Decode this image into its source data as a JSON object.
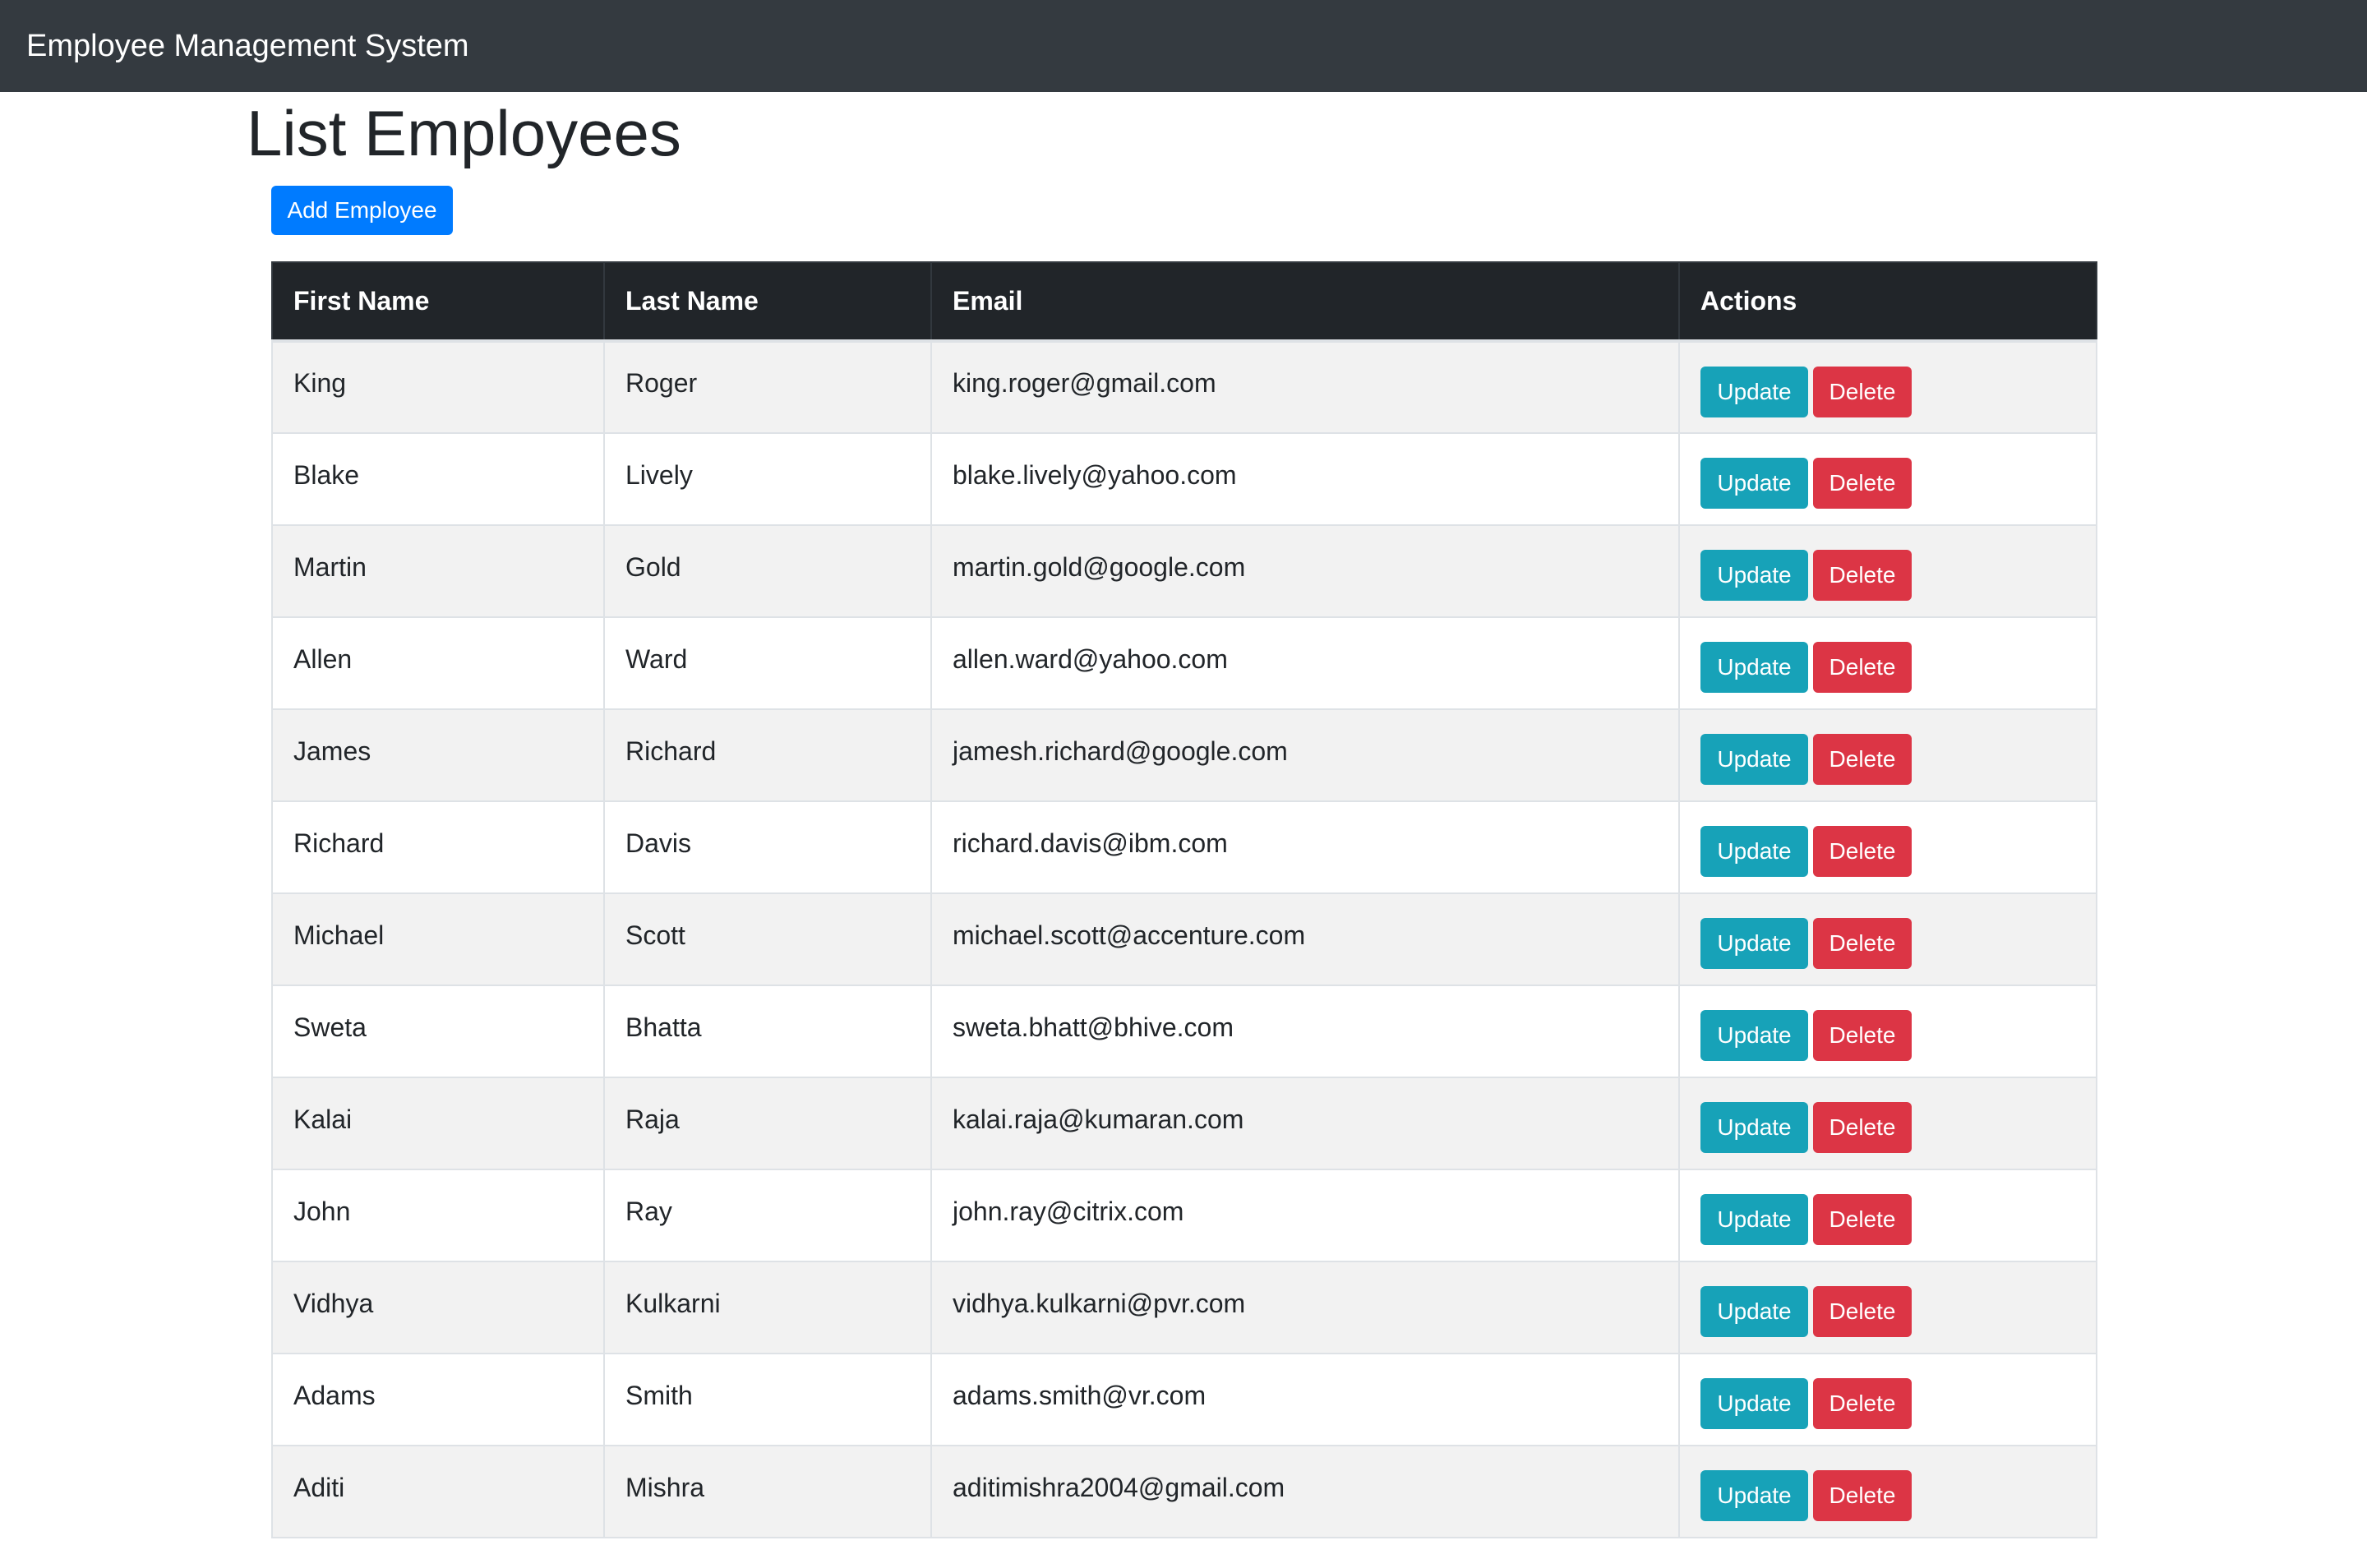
{
  "navbar": {
    "brand": "Employee Management System"
  },
  "page": {
    "title": "List Employees",
    "add_button_label": "Add Employee"
  },
  "table": {
    "headers": {
      "first_name": "First Name",
      "last_name": "Last Name",
      "email": "Email",
      "actions": "Actions"
    },
    "update_label": "Update",
    "delete_label": "Delete",
    "rows": [
      {
        "first_name": "King",
        "last_name": "Roger",
        "email": "king.roger@gmail.com"
      },
      {
        "first_name": "Blake",
        "last_name": "Lively",
        "email": "blake.lively@yahoo.com"
      },
      {
        "first_name": "Martin",
        "last_name": "Gold",
        "email": "martin.gold@google.com"
      },
      {
        "first_name": "Allen",
        "last_name": "Ward",
        "email": "allen.ward@yahoo.com"
      },
      {
        "first_name": "James",
        "last_name": "Richard",
        "email": "jamesh.richard@google.com"
      },
      {
        "first_name": "Richard",
        "last_name": "Davis",
        "email": "richard.davis@ibm.com"
      },
      {
        "first_name": "Michael",
        "last_name": "Scott",
        "email": "michael.scott@accenture.com"
      },
      {
        "first_name": "Sweta",
        "last_name": "Bhatta",
        "email": "sweta.bhatt@bhive.com"
      },
      {
        "first_name": "Kalai",
        "last_name": "Raja",
        "email": "kalai.raja@kumaran.com"
      },
      {
        "first_name": "John",
        "last_name": "Ray",
        "email": "john.ray@citrix.com"
      },
      {
        "first_name": "Vidhya",
        "last_name": "Kulkarni",
        "email": "vidhya.kulkarni@pvr.com"
      },
      {
        "first_name": "Adams",
        "last_name": "Smith",
        "email": "adams.smith@vr.com"
      },
      {
        "first_name": "Aditi",
        "last_name": "Mishra",
        "email": "aditimishra2004@gmail.com"
      }
    ]
  },
  "colors": {
    "navbar_bg": "#343a40",
    "primary": "#007bff",
    "info": "#17a2b8",
    "danger": "#dc3545",
    "table_header_bg": "#212529",
    "striped_row": "#f2f2f2"
  }
}
